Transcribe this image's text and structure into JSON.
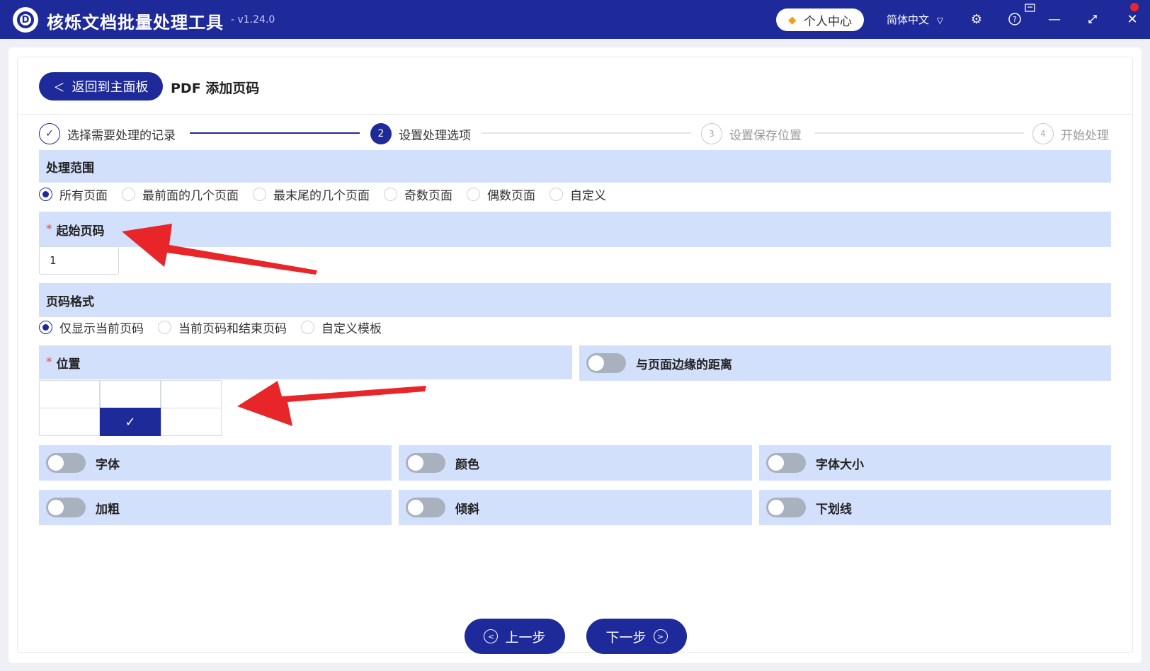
{
  "app": {
    "title": "核烁文档批量处理工具",
    "version": "- v1.24.0",
    "logo_letter": "D",
    "user_center": "个人中心",
    "language": "简体中文"
  },
  "header": {
    "back_label": "返回到主面板",
    "page_title": "PDF 添加页码"
  },
  "steps": [
    {
      "num": "✓",
      "label": "选择需要处理的记录"
    },
    {
      "num": "2",
      "label": "设置处理选项"
    },
    {
      "num": "3",
      "label": "设置保存位置"
    },
    {
      "num": "4",
      "label": "开始处理"
    }
  ],
  "range": {
    "title": "处理范围",
    "options": [
      "所有页面",
      "最前面的几个页面",
      "最末尾的几个页面",
      "奇数页面",
      "偶数页面",
      "自定义"
    ],
    "selected": "所有页面"
  },
  "start_page": {
    "title": "起始页码",
    "value": "1"
  },
  "format": {
    "title": "页码格式",
    "options": [
      "仅显示当前页码",
      "当前页码和结束页码",
      "自定义模板"
    ],
    "selected": "仅显示当前页码"
  },
  "position": {
    "title": "位置",
    "selected_mark": "✓",
    "margin_label": "与页面边缘的距离"
  },
  "style_toggles": {
    "font": "字体",
    "color": "颜色",
    "font_size": "字体大小",
    "bold": "加粗",
    "italic": "倾斜",
    "underline": "下划线"
  },
  "nav": {
    "prev": "上一步",
    "next": "下一步"
  },
  "colors": {
    "primary": "#1e2a9a",
    "section_bg": "#d3e0fb",
    "arrow": "#e8262a"
  }
}
